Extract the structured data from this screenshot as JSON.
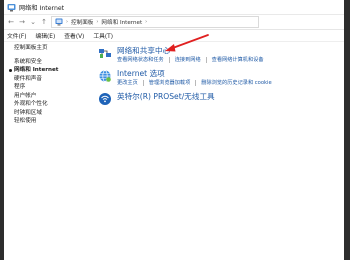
{
  "window": {
    "title": "网络和 Internet"
  },
  "address": {
    "back": "←",
    "forward": "→",
    "history": "⌄",
    "up": "↑",
    "crumbs": [
      "控制面板",
      "网络和 Internet"
    ]
  },
  "menu": {
    "file": "文件(F)",
    "edit": "编辑(E)",
    "view": "查看(V)",
    "tools": "工具(T)"
  },
  "sidebar": {
    "home": "控制面板主页",
    "items": [
      {
        "label": "系统和安全"
      },
      {
        "label": "网络和 Internet",
        "current": true
      },
      {
        "label": "硬件和声音"
      },
      {
        "label": "程序"
      },
      {
        "label": "用户帐户"
      },
      {
        "label": "外观和个性化"
      },
      {
        "label": "时钟和区域"
      },
      {
        "label": "轻松使用"
      }
    ]
  },
  "categories": [
    {
      "title": "网络和共享中心",
      "icon": "network-sharing-icon",
      "links": [
        "查看网络状态和任务",
        "连接到网络",
        "查看网络计算机和设备"
      ]
    },
    {
      "title": "Internet 选项",
      "icon": "internet-options-icon",
      "links": [
        "更改主页",
        "管理浏览器加载项",
        "删除浏览的历史记录和 cookie"
      ]
    },
    {
      "title": "英特尔(R) PROSet/无线工具",
      "icon": "intel-wireless-icon",
      "links": []
    }
  ],
  "colors": {
    "link": "#1f5aa6",
    "annotation_arrow": "#e02020"
  }
}
